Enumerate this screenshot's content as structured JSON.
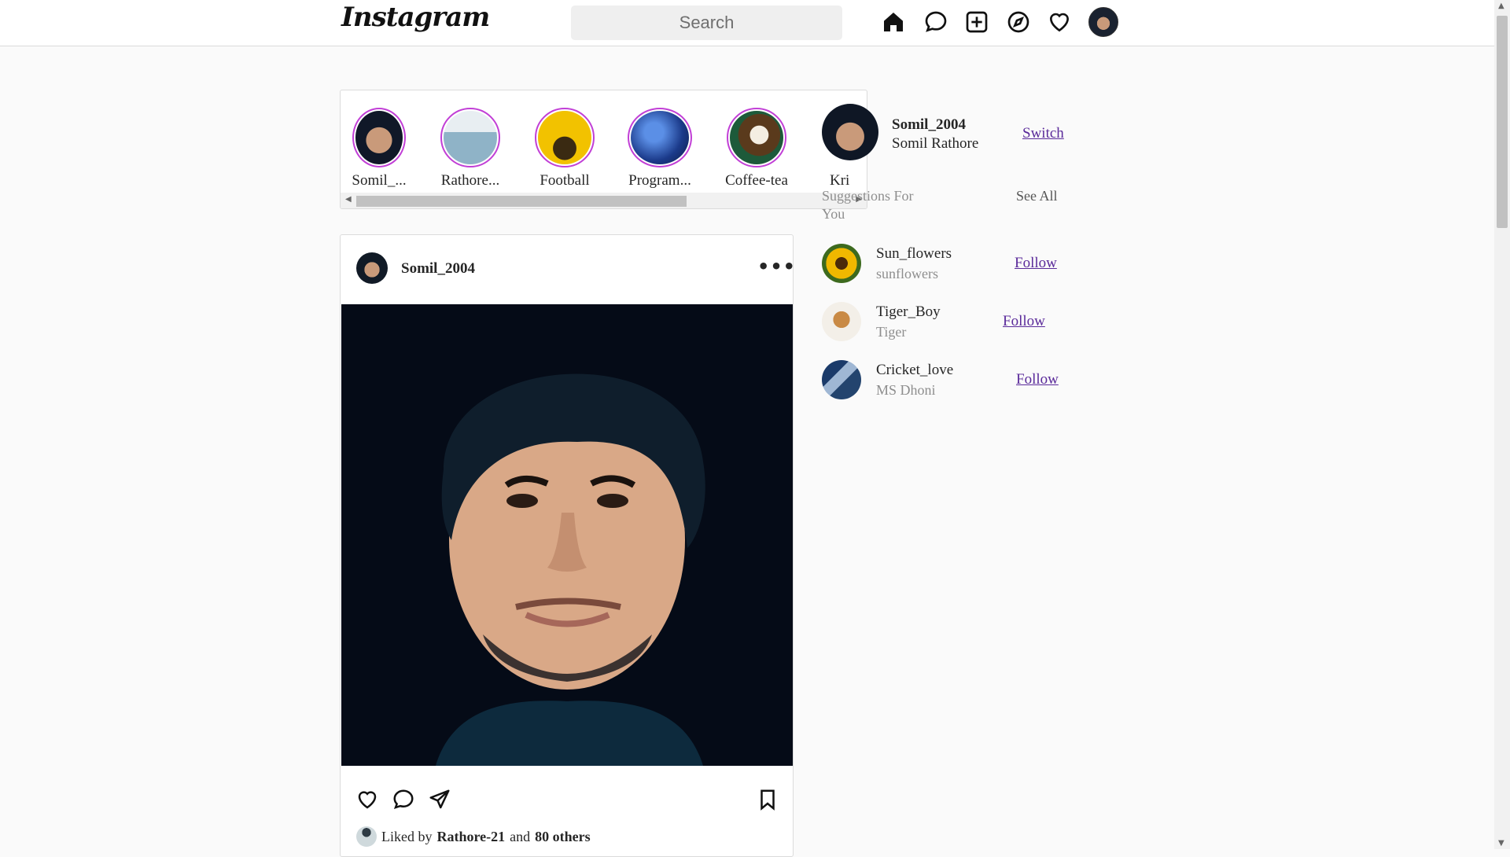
{
  "app": {
    "logo": "Instagram"
  },
  "search": {
    "placeholder": "Search"
  },
  "nav": {
    "icons": [
      "home-icon",
      "messenger-icon",
      "new-post-icon",
      "explore-icon",
      "activity-icon",
      "profile-avatar"
    ]
  },
  "stories": [
    {
      "label": "Somil_..."
    },
    {
      "label": "Rathore..."
    },
    {
      "label": "Football"
    },
    {
      "label": "Program..."
    },
    {
      "label": "Coffee-tea"
    },
    {
      "label": "Kri"
    }
  ],
  "post": {
    "username": "Somil_2004",
    "more": "•••",
    "liked_prefix": "Liked by",
    "liked_user": "Rathore-21",
    "liked_and": "and",
    "liked_others": "80 others"
  },
  "profile": {
    "username": "Somil_2004",
    "name": "Somil Rathore",
    "switch": "Switch"
  },
  "suggestions": {
    "title": "Suggestions For You",
    "see_all": "See All",
    "items": [
      {
        "username": "Sun_flowers",
        "subtitle": "sunflowers",
        "action": "Follow"
      },
      {
        "username": "Tiger_Boy",
        "subtitle": "Tiger",
        "action": "Follow"
      },
      {
        "username": "Cricket_love",
        "subtitle": "MS Dhoni",
        "action": "Follow"
      }
    ]
  },
  "colors": {
    "story_ring": "#c13fd6",
    "link": "#5a2a9a",
    "muted": "#8e8e8e"
  }
}
